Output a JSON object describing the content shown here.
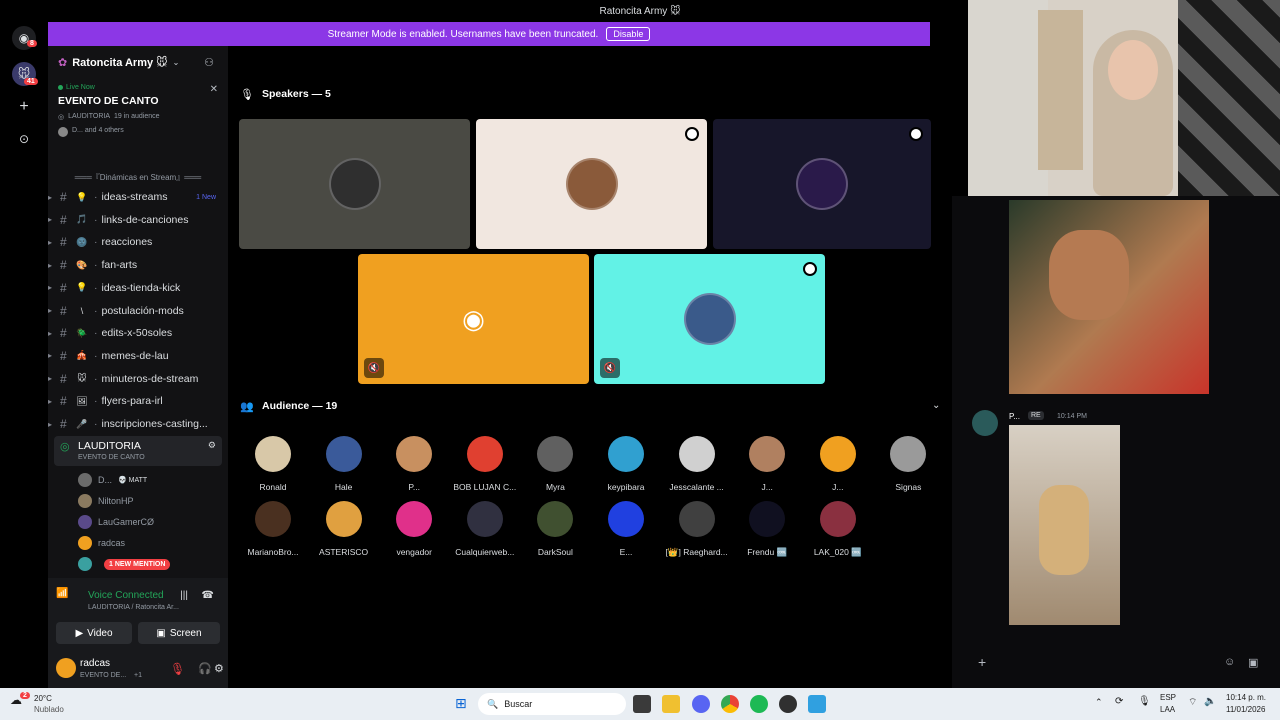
{
  "window": {
    "title": "Ratoncita Army 🐭"
  },
  "banner": {
    "text": "Streamer Mode is enabled. Usernames have been truncated.",
    "button": "Disable"
  },
  "rail": {
    "badge_top": "8",
    "badge_server": "41"
  },
  "server": {
    "name": "Ratoncita Army 🐭"
  },
  "live": {
    "label": "Live Now",
    "event": "EVENTO DE CANTO",
    "stage": "LAUDITORIA",
    "audience": "19 in audience",
    "others": "D... and 4 others"
  },
  "category": {
    "label": "═══『Dinámicas en Stream』═══"
  },
  "channels": [
    {
      "emoji": "💡",
      "name": "ideas-streams",
      "badge": "1 New"
    },
    {
      "emoji": "🎵",
      "name": "links-de-canciones",
      "badge": ""
    },
    {
      "emoji": "🌚",
      "name": "reacciones",
      "badge": ""
    },
    {
      "emoji": "🎨",
      "name": "fan-arts",
      "badge": ""
    },
    {
      "emoji": "💡",
      "name": "ideas-tienda-kick",
      "badge": ""
    },
    {
      "emoji": "\\",
      "name": "postulación-mods",
      "badge": ""
    },
    {
      "emoji": "🪲",
      "name": "edits-x-50soles",
      "badge": ""
    },
    {
      "emoji": "🎪",
      "name": "memes-de-lau",
      "badge": ""
    },
    {
      "emoji": "🐭",
      "name": "minuteros-de-stream",
      "badge": ""
    },
    {
      "emoji": "🖼",
      "name": "flyers-para-irl",
      "badge": ""
    },
    {
      "emoji": "🎤",
      "name": "inscripciones-casting...",
      "badge": ""
    }
  ],
  "stage_channel": {
    "name": "LAUDITORIA",
    "sub": "EVENTO DE CANTO"
  },
  "voice_users": [
    {
      "name": "D...",
      "tag": "💀 MATT",
      "color": "#6b6b6b"
    },
    {
      "name": "NiltonHP",
      "tag": "",
      "color": "#8a7a60"
    },
    {
      "name": "LauGamerCØ",
      "tag": "",
      "color": "#5a4a8a"
    },
    {
      "name": "radcas",
      "tag": "",
      "color": "#f0a020"
    },
    {
      "name": "",
      "tag": "1 NEW MENTION",
      "color": "#3aa0a0"
    }
  ],
  "voice": {
    "status": "Voice Connected",
    "channel": "LAUDITORIA / Ratoncita Ar...",
    "video": "Video",
    "screen": "Screen"
  },
  "me": {
    "name": "radcas",
    "status": "EVENTO DE...",
    "plus": "+1"
  },
  "speakers": {
    "heading": "Speakers — 5"
  },
  "speaker_tiles": [
    {
      "bg": "#4a4a44",
      "avatar": "#2f2f2f"
    },
    {
      "bg": "#f1e7e0",
      "avatar": "#8a5a3a"
    },
    {
      "bg": "#17162a",
      "avatar": "#2a1a4a"
    },
    {
      "bg": "#f0a020",
      "avatar": "#f0a020"
    },
    {
      "bg": "#62f2e6",
      "avatar": "#3a5a8a"
    }
  ],
  "audience": {
    "heading": "Audience — 19"
  },
  "audience_members": [
    {
      "name": "Ronald",
      "color": "#d8c8a8"
    },
    {
      "name": "Hale",
      "color": "#3a5a9a"
    },
    {
      "name": "P...",
      "color": "#c89060"
    },
    {
      "name": "BOB LUJAN C...",
      "color": "#e04030"
    },
    {
      "name": "Myra",
      "color": "#606060"
    },
    {
      "name": "keypibara",
      "color": "#30a0d0"
    },
    {
      "name": "Jesscalante ...",
      "color": "#d0d0d0"
    },
    {
      "name": "J...",
      "color": "#b08060"
    },
    {
      "name": "J...",
      "color": "#f0a020"
    },
    {
      "name": "Signas",
      "color": "#9a9a9a"
    },
    {
      "name": "MarianoBro...",
      "color": "#4a3020"
    },
    {
      "name": "ASTERISCO",
      "color": "#e0a040"
    },
    {
      "name": "vengador",
      "color": "#e0308a"
    },
    {
      "name": "Cualquierweb...",
      "color": "#303040"
    },
    {
      "name": "DarkSoul",
      "color": "#405030"
    },
    {
      "name": "E...",
      "color": "#2040e0"
    },
    {
      "name": "[👑] Raeghard...",
      "color": "#404040"
    },
    {
      "name": "Frendu 🆒",
      "color": "#101020"
    },
    {
      "name": "LAK_020 🆒",
      "color": "#8a3040"
    }
  ],
  "chat": {
    "author": "P...",
    "tag": "RE",
    "time": "10:14 PM"
  },
  "taskbar": {
    "weather_temp": "20°C",
    "weather_desc": "Nublado",
    "search": "Buscar",
    "lang1": "ESP",
    "lang2": "LAA",
    "time": "10:14 p. m.",
    "date": "11/01/2026",
    "notif": "2"
  }
}
